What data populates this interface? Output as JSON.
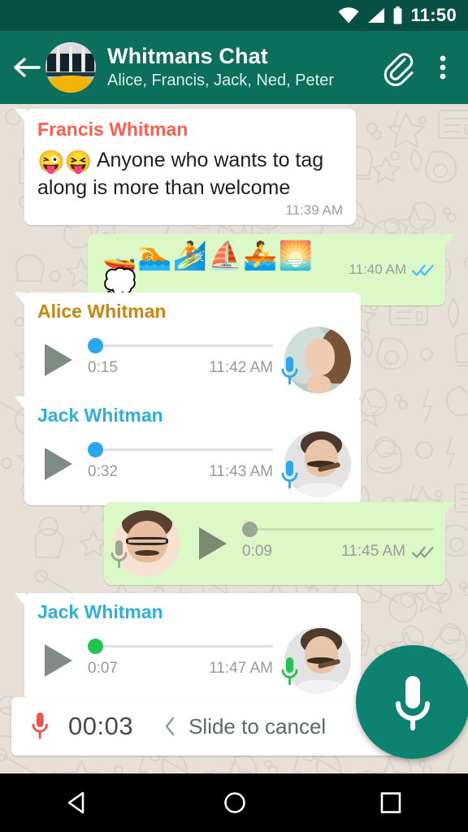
{
  "status_bar": {
    "time": "11:50",
    "icons": [
      "wifi-icon",
      "cellular-signal-icon",
      "battery-icon"
    ]
  },
  "app_bar": {
    "back_icon": "back-arrow-icon",
    "avatar": "group-avatar-boat",
    "title": "Whitmans Chat",
    "subtitle": "Alice, Francis, Jack, Ned, Peter",
    "attach_icon": "paperclip-icon",
    "menu_icon": "overflow-menu-icon"
  },
  "colors": {
    "app_bar": "#0b6f5c",
    "status_bar": "#075044",
    "chat_bg": "#e7e0d8",
    "incoming_bubble": "#ffffff",
    "outgoing_bubble": "#dcf8c6",
    "read_tick": "#4fc3f7",
    "fab": "#0d8271",
    "record_mic": "#ef5350",
    "sender_francis": "#ff5e4d",
    "sender_alice": "#c8860d",
    "sender_jack": "#30b0d8",
    "unplayed_voice": "#2aa7ee",
    "new_voice": "#23c552",
    "played_voice": "#9aa592"
  },
  "messages": [
    {
      "id": "msg-francis-text",
      "type": "text",
      "direction": "incoming",
      "sender": "Francis Whitman",
      "sender_color": "#ff5e4d",
      "emojis": "😜😝",
      "text": "Anyone who wants to tag along is more than welcome",
      "time": "11:39 AM"
    },
    {
      "id": "msg-outgoing-emoji",
      "type": "emoji",
      "direction": "outgoing",
      "emojis": "🚤🏊🏄⛵🚣🌅💭",
      "time": "11:40 AM",
      "ticks": "read-double-check"
    },
    {
      "id": "msg-alice-voice",
      "type": "voice",
      "direction": "incoming",
      "sender": "Alice Whitman",
      "sender_color": "#c8860d",
      "duration": "0:15",
      "time": "11:42 AM",
      "mic_state": "unplayed",
      "avatar": "alice-avatar"
    },
    {
      "id": "msg-jack-voice-1",
      "type": "voice",
      "direction": "incoming",
      "sender": "Jack Whitman",
      "sender_color": "#30b0d8",
      "duration": "0:32",
      "time": "11:43 AM",
      "mic_state": "unplayed",
      "avatar": "jack-avatar"
    },
    {
      "id": "msg-outgoing-voice",
      "type": "voice",
      "direction": "outgoing",
      "sender": "",
      "duration": "0:09",
      "time": "11:45 AM",
      "mic_state": "played",
      "avatar": "self-avatar",
      "ticks": "read-double-check"
    },
    {
      "id": "msg-jack-voice-2",
      "type": "voice",
      "direction": "incoming",
      "sender": "Jack Whitman",
      "sender_color": "#30b0d8",
      "duration": "0:07",
      "time": "11:47 AM",
      "mic_state": "new",
      "avatar": "jack-avatar"
    }
  ],
  "recording_bar": {
    "mic_icon": "recording-mic-icon",
    "elapsed": "00:03",
    "chevron_icon": "chevron-left-icon",
    "slide_label": "Slide to cancel",
    "send_icon": "mic-fab-icon"
  },
  "nav_bar": {
    "back": "nav-back-icon",
    "home": "nav-home-icon",
    "recents": "nav-recents-icon"
  }
}
